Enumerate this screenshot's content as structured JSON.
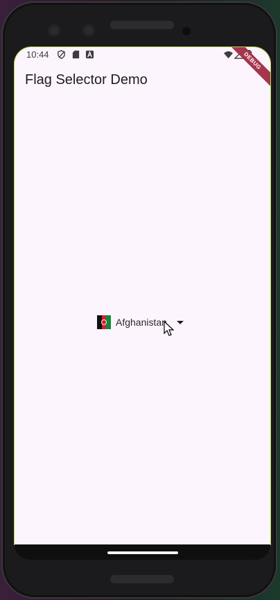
{
  "status_bar": {
    "time": "10:44",
    "left_icons": [
      "shield-icon",
      "sd-card-icon",
      "font-a-icon"
    ],
    "right_icons": [
      "wifi-icon",
      "signal-icon",
      "battery-icon"
    ]
  },
  "debug_banner": "DEBUG",
  "app_bar": {
    "title": "Flag Selector Demo"
  },
  "country_dropdown": {
    "selected_value": "Afghanistan",
    "selected_flag": "afghanistan-flag-icon",
    "caret_icon": "arrow-drop-down-icon"
  },
  "colors": {
    "background": "#fdf5fd",
    "debug_banner": "#a6364c",
    "text": "#1f1b20"
  }
}
